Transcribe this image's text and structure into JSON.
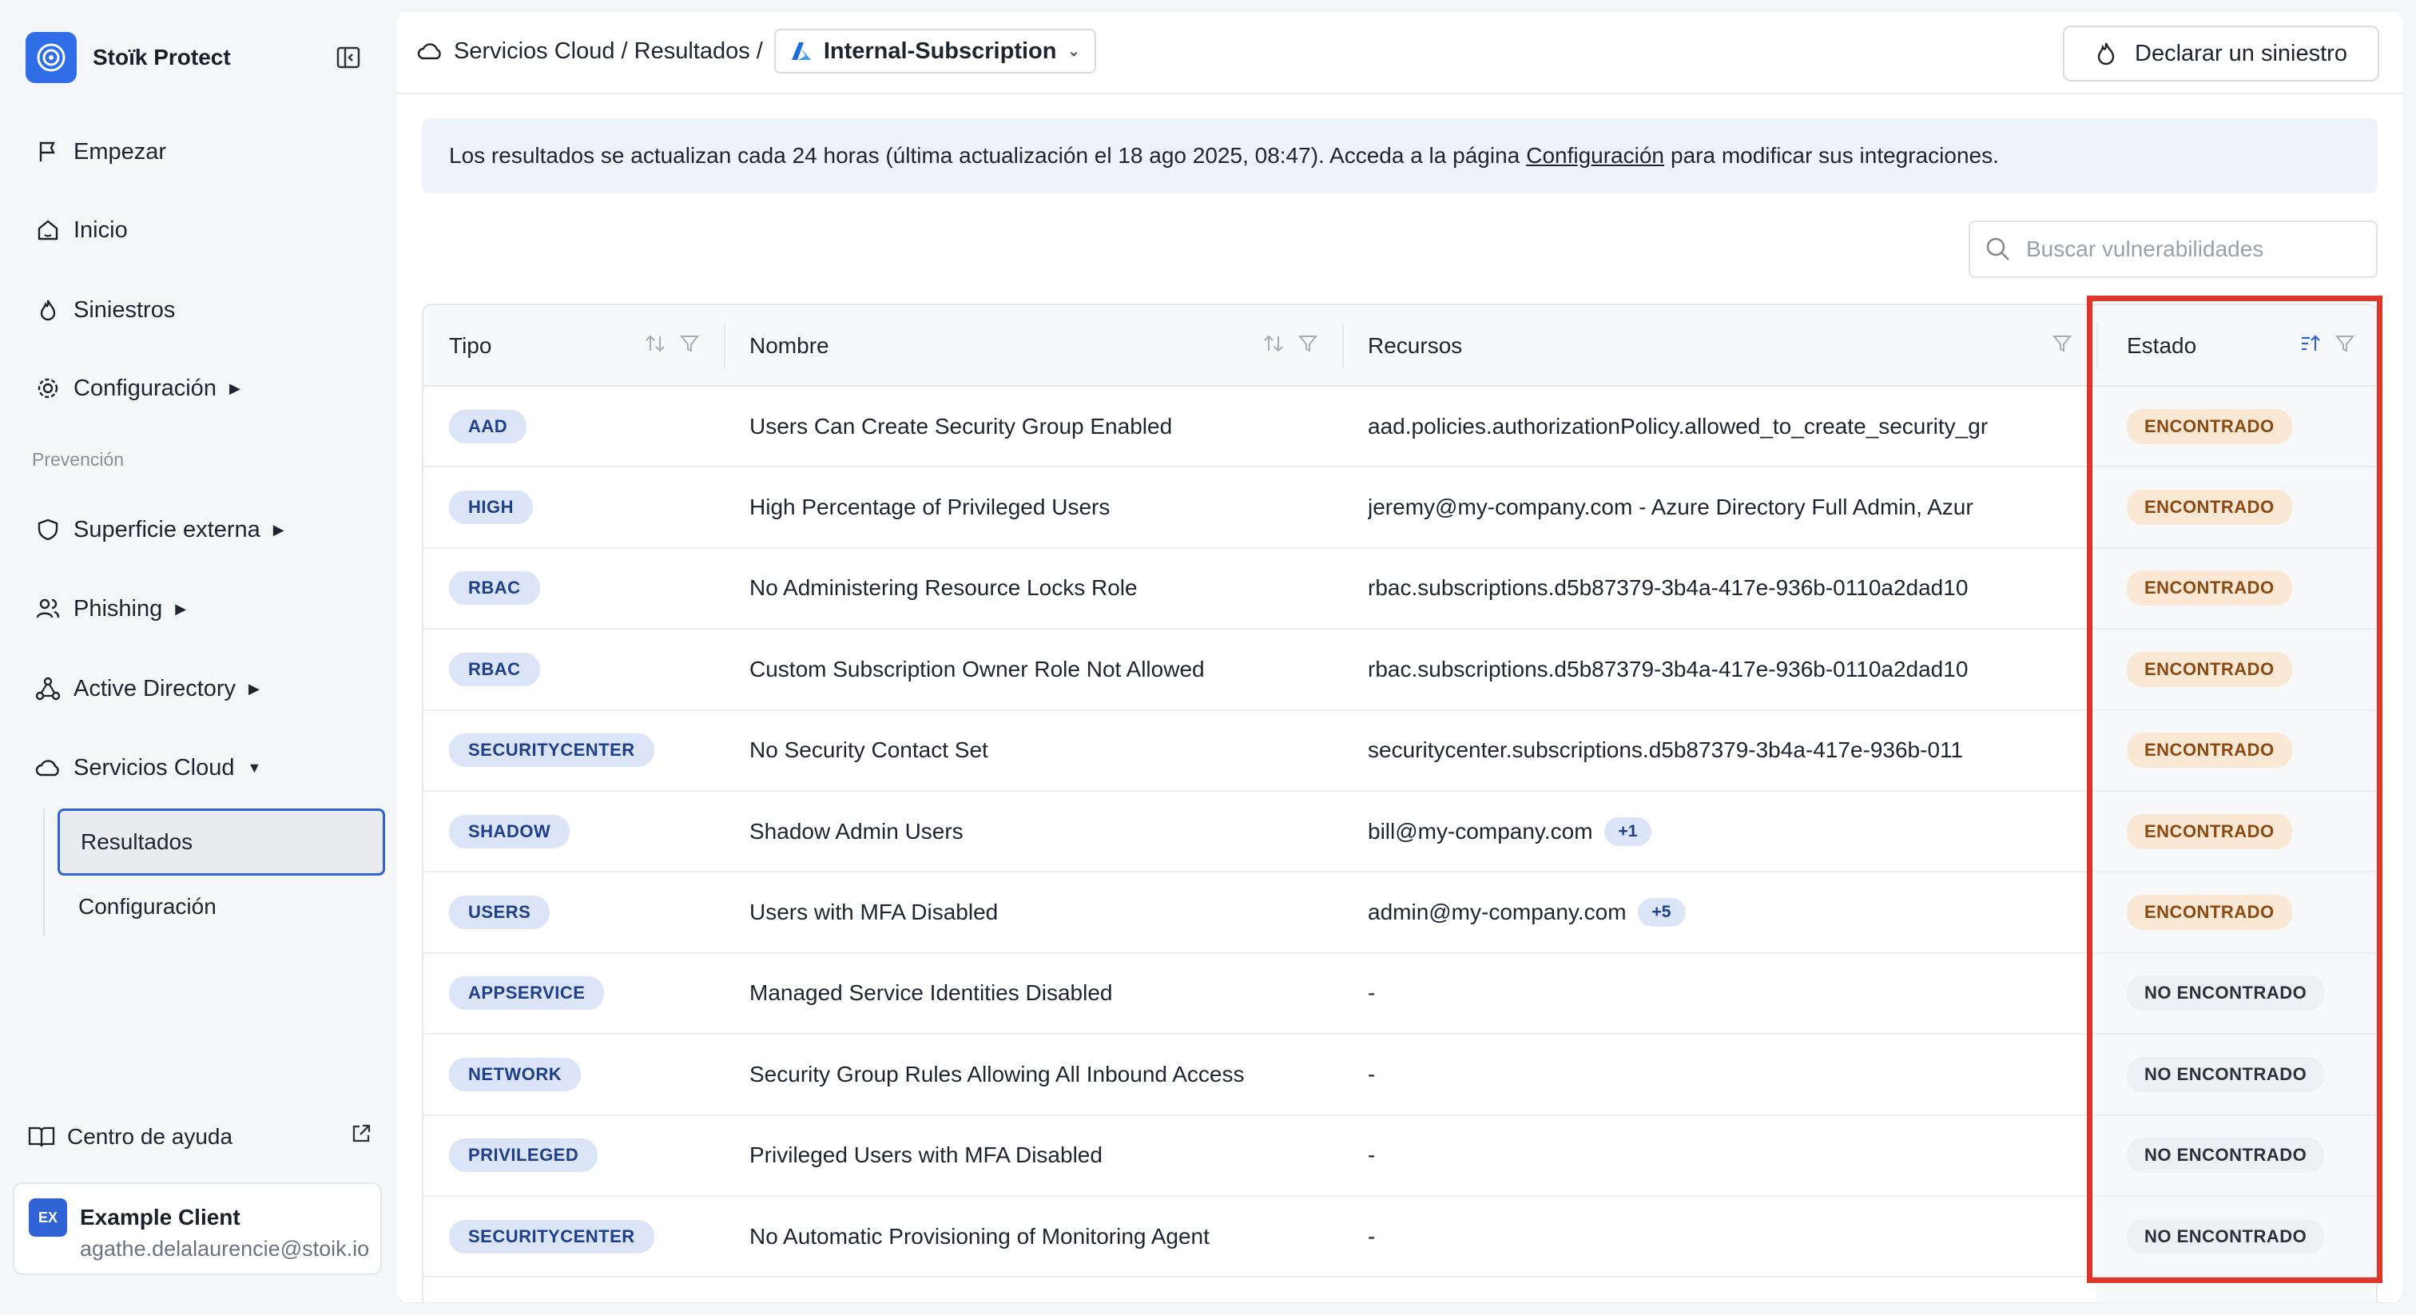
{
  "app": {
    "name": "Stoïk Protect"
  },
  "sidebar": {
    "items": [
      {
        "label": "Empezar",
        "icon": "flag-icon"
      },
      {
        "label": "Inicio",
        "icon": "home-icon"
      },
      {
        "label": "Siniestros",
        "icon": "flame-icon"
      },
      {
        "label": "Configuración",
        "icon": "gear-icon"
      }
    ],
    "section_label": "Prevención",
    "prevention_items": [
      {
        "label": "Superficie externa",
        "icon": "shield-icon"
      },
      {
        "label": "Phishing",
        "icon": "users-icon"
      },
      {
        "label": "Active Directory",
        "icon": "network-icon"
      },
      {
        "label": "Servicios Cloud",
        "icon": "cloud-icon"
      }
    ],
    "cloud_sub": {
      "results": "Resultados",
      "config": "Configuración"
    },
    "help": "Centro de ayuda",
    "client": {
      "initials": "EX",
      "name": "Example Client",
      "email": "agathe.delalaurencie@stoik.io"
    }
  },
  "header": {
    "breadcrumb": "Servicios Cloud / Resultados /",
    "subscription": "Internal-Subscription",
    "declare_label": "Declarar un siniestro"
  },
  "banner": {
    "text_before": "Los resultados se actualizan cada 24 horas (última actualización el 18 ago 2025, 08:47). Acceda a la página",
    "link": "Configuración",
    "text_after": "para modificar sus integraciones."
  },
  "search": {
    "placeholder": "Buscar vulnerabilidades"
  },
  "table": {
    "headers": {
      "tipo": "Tipo",
      "nombre": "Nombre",
      "recursos": "Recursos",
      "estado": "Estado"
    },
    "rows": [
      {
        "tipo": "AAD",
        "nombre": "Users Can Create Security Group Enabled",
        "recursos": "aad.policies.authorizationPolicy.allowed_to_create_security_gr",
        "extra": "",
        "estado": "ENCONTRADO",
        "found": true
      },
      {
        "tipo": "HIGH",
        "nombre": "High Percentage of Privileged Users",
        "recursos": "jeremy@my-company.com - Azure Directory Full Admin, Azur",
        "extra": "",
        "estado": "ENCONTRADO",
        "found": true
      },
      {
        "tipo": "RBAC",
        "nombre": "No Administering Resource Locks Role",
        "recursos": "rbac.subscriptions.d5b87379-3b4a-417e-936b-0110a2dad10",
        "extra": "",
        "estado": "ENCONTRADO",
        "found": true
      },
      {
        "tipo": "RBAC",
        "nombre": "Custom Subscription Owner Role Not Allowed",
        "recursos": "rbac.subscriptions.d5b87379-3b4a-417e-936b-0110a2dad10",
        "extra": "",
        "estado": "ENCONTRADO",
        "found": true
      },
      {
        "tipo": "SECURITYCENTER",
        "nombre": "No Security Contact Set",
        "recursos": "securitycenter.subscriptions.d5b87379-3b4a-417e-936b-011",
        "extra": "",
        "estado": "ENCONTRADO",
        "found": true
      },
      {
        "tipo": "SHADOW",
        "nombre": "Shadow Admin Users",
        "recursos": "bill@my-company.com",
        "extra": "+1",
        "estado": "ENCONTRADO",
        "found": true
      },
      {
        "tipo": "USERS",
        "nombre": "Users with MFA Disabled",
        "recursos": "admin@my-company.com",
        "extra": "+5",
        "estado": "ENCONTRADO",
        "found": true
      },
      {
        "tipo": "APPSERVICE",
        "nombre": "Managed Service Identities Disabled",
        "recursos": "-",
        "extra": "",
        "estado": "NO ENCONTRADO",
        "found": false
      },
      {
        "tipo": "NETWORK",
        "nombre": "Security Group Rules Allowing All Inbound Access",
        "recursos": "-",
        "extra": "",
        "estado": "NO ENCONTRADO",
        "found": false
      },
      {
        "tipo": "PRIVILEGED",
        "nombre": "Privileged Users with MFA Disabled",
        "recursos": "-",
        "extra": "",
        "estado": "NO ENCONTRADO",
        "found": false
      },
      {
        "tipo": "SECURITYCENTER",
        "nombre": "No Automatic Provisioning of Monitoring Agent",
        "recursos": "-",
        "extra": "",
        "estado": "NO ENCONTRADO",
        "found": false
      }
    ]
  },
  "colors": {
    "accent": "#2f63d6",
    "highlight": "#e0352b",
    "found_bg": "#fbe8d4"
  }
}
